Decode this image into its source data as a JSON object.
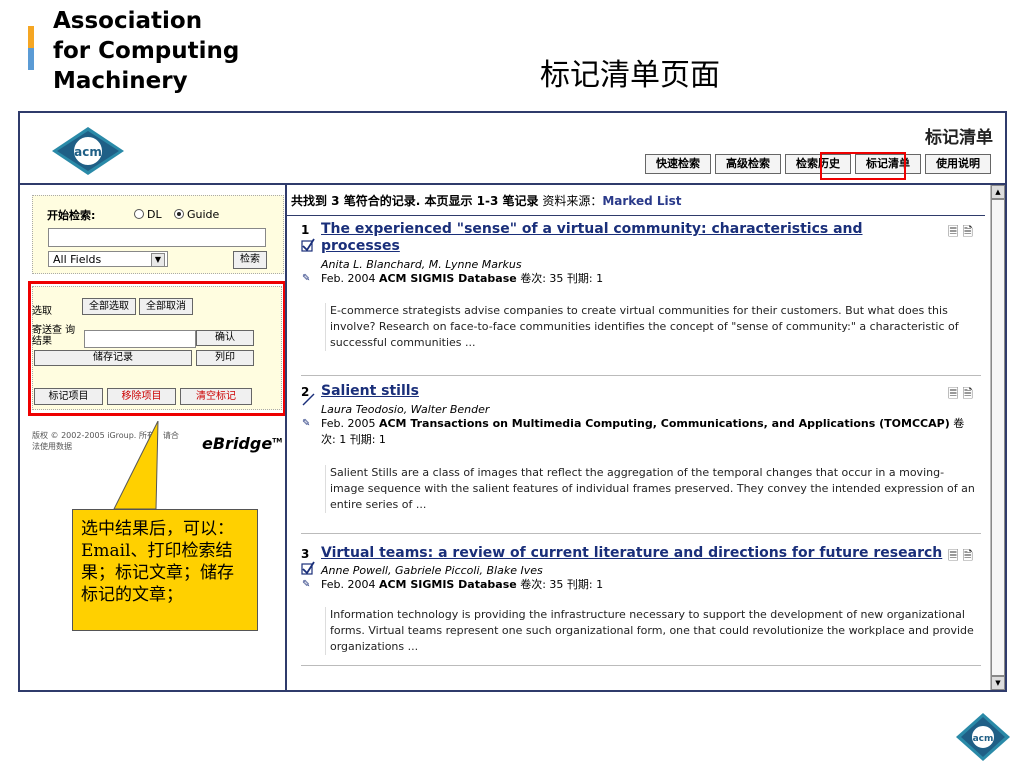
{
  "slide": {
    "org_line1": "Association",
    "org_line2": "for Computing",
    "org_line3": "Machinery",
    "title": "标记清单页面"
  },
  "page": {
    "heading": "标记清单",
    "tabs": [
      "快速检索",
      "高级检索",
      "检索历史",
      "标记清单",
      "使用说明"
    ],
    "highlight_color": "#e00000"
  },
  "search": {
    "label": "开始检索:",
    "radio_dl": "DL",
    "radio_guide": "Guide",
    "selected_radio": "Guide",
    "query_value": "",
    "fields_value": "All Fields",
    "submit_label": "检索"
  },
  "actions": {
    "select_label": "选取",
    "select_all": "全部选取",
    "unselect_all": "全部取消",
    "send_label": "寄送查 询结果",
    "email_value": "",
    "confirm": "确认",
    "save": "储存记录",
    "print": "列印",
    "mark": "标记项目",
    "remove": "移除项目",
    "clear": "清空标记"
  },
  "footer": {
    "copyright": "版权 © 2002-2005 iGroup. 所有。请合法使用数据",
    "brand": "eBridge",
    "brand_tm": "TM"
  },
  "callout": {
    "text": "选中结果后，可以：Email、打印检索结果；标记文章；储存标记的文章；"
  },
  "results": {
    "summary_prefix": "共找到 3 笔符合的记录. 本页显示 1-3 笔记录",
    "summary_source_label": "资料来源：",
    "summary_source": "Marked List",
    "items": [
      {
        "num": "1",
        "title_line1": "The experienced \"sense\" of a virtual community: characteristics and",
        "title_line2": "processes",
        "authors": "Anita L. Blanchard, M. Lynne Markus",
        "date": "Feb. 2004",
        "venue": "ACM SIGMIS Database",
        "volume": "卷次: 35 刊期: 1",
        "abstract": "E-commerce strategists advise companies to create virtual communities for their customers. But what does this involve? Research on face-to-face communities identifies the concept of \"sense of community:\" a characteristic of successful communities ..."
      },
      {
        "num": "2",
        "title_line1": "Salient stills",
        "authors": "Laura Teodosio, Walter Bender",
        "date": "Feb. 2005",
        "venue": "ACM Transactions on Multimedia Computing, Communications, and Applications (TOMCCAP)",
        "volume": "卷次: 1 刊期: 1",
        "abstract": "Salient Stills are a class of images that reflect the aggregation of the temporal changes that occur in a moving-image sequence with the salient features of individual frames preserved. They convey the intended expression of an entire series of ..."
      },
      {
        "num": "3",
        "title_line1": "Virtual teams: a review of current literature and directions for future research",
        "authors": "Anne Powell, Gabriele Piccoli, Blake Ives",
        "date": "Feb. 2004",
        "venue": "ACM SIGMIS Database",
        "volume": "卷次: 35 刊期: 1",
        "abstract": "Information technology is providing the infrastructure necessary to support the development of new organizational forms. Virtual teams represent one such organizational form, one that could revolutionize the workplace and provide organizations ..."
      }
    ]
  },
  "logo": {
    "text": "acm"
  }
}
